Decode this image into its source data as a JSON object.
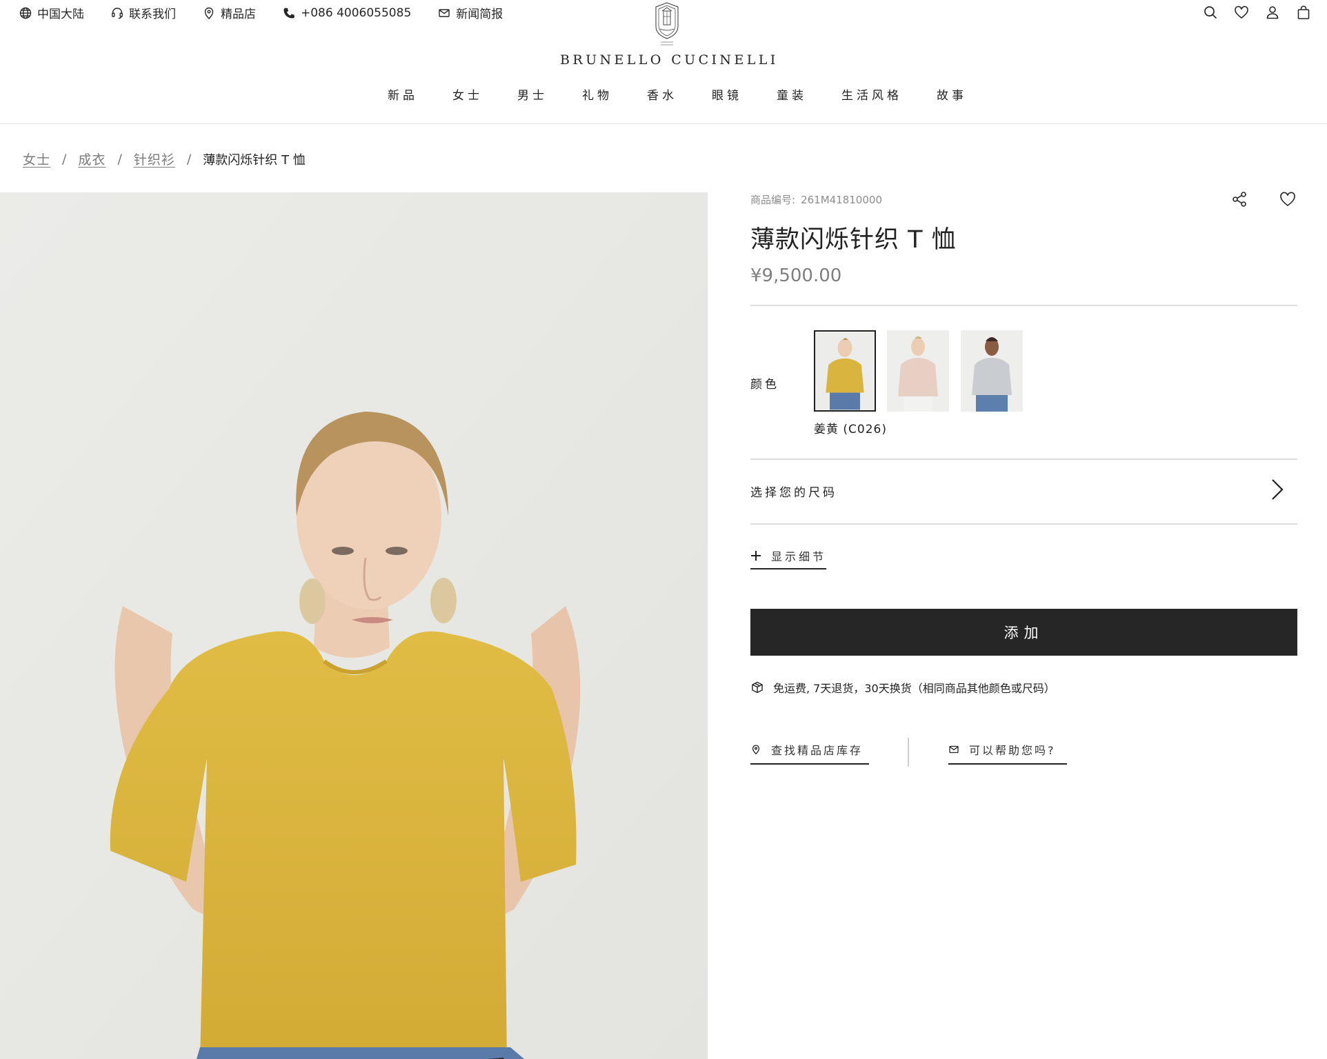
{
  "utility_bar": {
    "region": "中国大陆",
    "contact": "联系我们",
    "stores": "精品店",
    "phone": "+086 4006055085",
    "newsletter": "新闻简报"
  },
  "brand": {
    "name": "BRUNELLO CUCINELLI"
  },
  "nav": [
    "新品",
    "女士",
    "男士",
    "礼物",
    "香水",
    "眼镜",
    "童装",
    "生活风格",
    "故事"
  ],
  "breadcrumb": {
    "items": [
      "女士",
      "成衣",
      "针织衫"
    ],
    "separator": "/",
    "current": "薄款闪烁针织 T 恤"
  },
  "product": {
    "sku_label": "商品编号:",
    "sku": "261M41810000",
    "title": "薄款闪烁针织 T 恤",
    "price": "¥9,500.00",
    "color_label": "颜色",
    "selected_color": "姜黄 (C026)",
    "swatches": [
      {
        "name": "mustard",
        "color": "#d9b43e",
        "selected": true
      },
      {
        "name": "blush",
        "color": "#e8cfc4",
        "selected": false
      },
      {
        "name": "grey",
        "color": "#c9ccd1",
        "selected": false
      }
    ],
    "size_label": "选择您的尺码",
    "details_label": "显示细节",
    "add_button": "添加",
    "shipping_note": "免运费, 7天退货，30天换货（相同商品其他颜色或尺码）",
    "find_in_store": "查找精品店库存",
    "help": "可以帮助您吗?"
  },
  "icons": {
    "header_right": [
      "search-icon",
      "heart-icon",
      "user-icon",
      "bag-icon"
    ],
    "panel": [
      "share-icon",
      "wishlist-heart-icon"
    ]
  },
  "colors": {
    "accent_dark": "#262626",
    "muted_text": "#7f7f7f",
    "shirt_mustard": "#d9b43e"
  }
}
